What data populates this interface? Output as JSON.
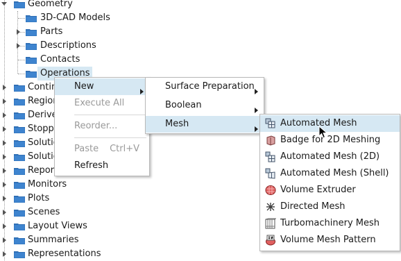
{
  "tree": {
    "items": [
      {
        "label": "Geometry"
      },
      {
        "label": "3D-CAD Models"
      },
      {
        "label": "Parts"
      },
      {
        "label": "Descriptions"
      },
      {
        "label": "Contacts"
      },
      {
        "label": "Operations"
      },
      {
        "label": "Contin"
      },
      {
        "label": "Region"
      },
      {
        "label": "Derive"
      },
      {
        "label": "Stopp"
      },
      {
        "label": "Solutio"
      },
      {
        "label": "Solutio"
      },
      {
        "label": "Repor"
      },
      {
        "label": "Monitors"
      },
      {
        "label": "Plots"
      },
      {
        "label": "Scenes"
      },
      {
        "label": "Layout Views"
      },
      {
        "label": "Summaries"
      },
      {
        "label": "Representations"
      }
    ]
  },
  "context_menu": {
    "new": "New",
    "execute_all": "Execute All",
    "reorder": "Reorder...",
    "paste": "Paste",
    "paste_shortcut": "Ctrl+V",
    "refresh": "Refresh"
  },
  "new_submenu": {
    "surface_preparation": "Surface Preparation",
    "boolean": "Boolean",
    "mesh": "Mesh"
  },
  "mesh_submenu": {
    "items": [
      {
        "label": "Automated Mesh",
        "icon": "automated-mesh-icon"
      },
      {
        "label": "Badge for 2D Meshing",
        "icon": "badge-2d-icon"
      },
      {
        "label": "Automated Mesh (2D)",
        "icon": "automated-mesh-2d-icon"
      },
      {
        "label": "Automated Mesh (Shell)",
        "icon": "automated-mesh-shell-icon"
      },
      {
        "label": "Volume Extruder",
        "icon": "volume-extruder-icon"
      },
      {
        "label": "Directed Mesh",
        "icon": "directed-mesh-icon"
      },
      {
        "label": "Turbomachinery Mesh",
        "icon": "turbomachinery-mesh-icon"
      },
      {
        "label": "Volume Mesh Pattern",
        "icon": "volume-mesh-pattern-icon"
      }
    ]
  },
  "colors": {
    "folder": "#2f6fb5",
    "highlight": "#d6e8f3"
  }
}
